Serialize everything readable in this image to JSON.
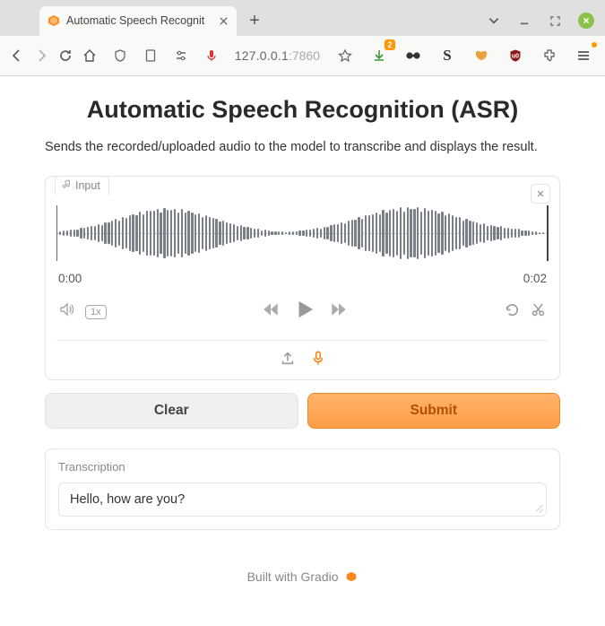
{
  "browser": {
    "tab_title": "Automatic Speech Recognit",
    "url_host": "127.0.0.1",
    "url_port": ":7860",
    "download_badge": "2"
  },
  "page": {
    "title": "Automatic Speech Recognition (ASR)",
    "description": "Sends the recorded/uploaded audio to the model to transcribe and displays the result."
  },
  "audio": {
    "label": "Input",
    "time_start": "0:00",
    "time_end": "0:02",
    "speed": "1x"
  },
  "buttons": {
    "clear": "Clear",
    "submit": "Submit"
  },
  "output": {
    "label": "Transcription",
    "value": "Hello, how are you?"
  },
  "footer": {
    "text": "Built with Gradio"
  }
}
